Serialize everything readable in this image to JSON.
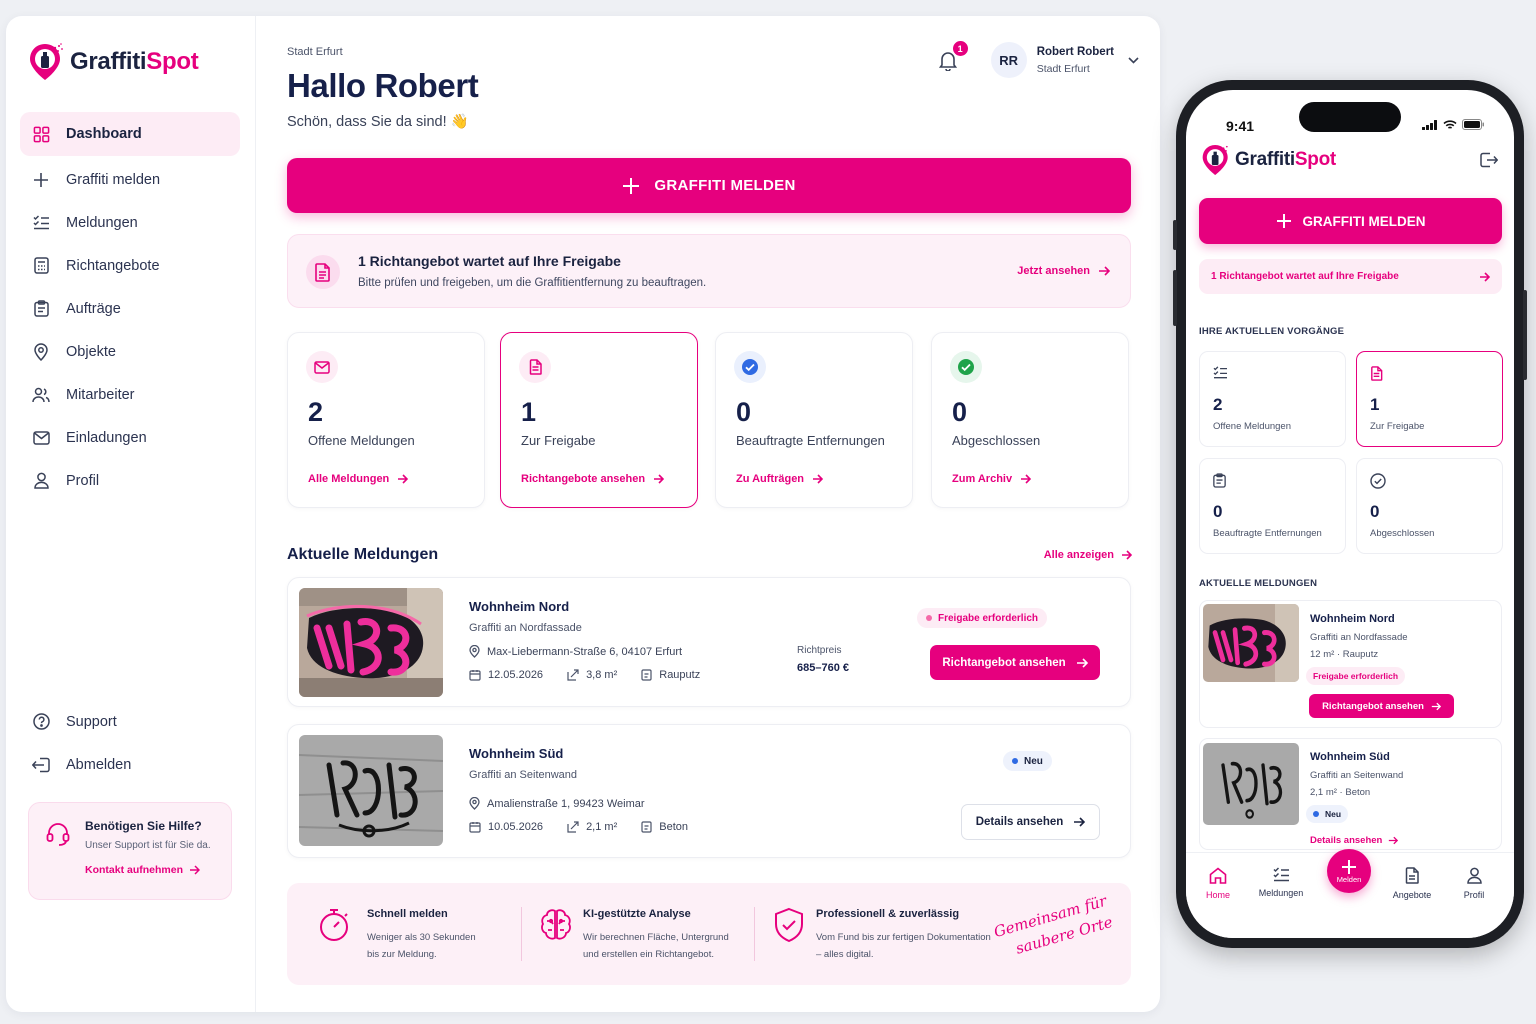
{
  "brand": {
    "name_part1": "Graffiti",
    "name_part2": "Spot",
    "accent": "#e6007e",
    "navy": "#16204a"
  },
  "sidebar": {
    "items": [
      {
        "label": "Dashboard",
        "icon": "grid-icon",
        "active": true
      },
      {
        "label": "Graffiti melden",
        "icon": "plus-icon"
      },
      {
        "label": "Meldungen",
        "icon": "list-check-icon"
      },
      {
        "label": "Richtangebote",
        "icon": "calculator-icon"
      },
      {
        "label": "Aufträge",
        "icon": "clipboard-icon"
      },
      {
        "label": "Objekte",
        "icon": "map-pin-icon"
      },
      {
        "label": "Mitarbeiter",
        "icon": "users-icon"
      },
      {
        "label": "Einladungen",
        "icon": "mail-icon"
      },
      {
        "label": "Profil",
        "icon": "user-icon"
      }
    ],
    "bottom": [
      {
        "label": "Support",
        "icon": "help-circle-icon"
      },
      {
        "label": "Abmelden",
        "icon": "logout-icon"
      }
    ],
    "help": {
      "title": "Benötigen Sie Hilfe?",
      "text": "Unser Support ist für Sie da.",
      "link": "Kontakt aufnehmen"
    }
  },
  "header": {
    "breadcrumb": "Stadt Erfurt",
    "greeting": "Hallo Robert",
    "subtitle": "Schön, dass Sie da sind! 👋",
    "notifications": "1",
    "user": {
      "initials": "RR",
      "name": "Robert Robert",
      "org": "Stadt Erfurt"
    }
  },
  "cta": {
    "label": "GRAFFITI MELDEN"
  },
  "notice": {
    "title": "1 Richtangebot wartet auf Ihre Freigabe",
    "text": "Bitte prüfen und freigeben, um die Graffitientfernung zu beauftragen.",
    "link": "Jetzt ansehen"
  },
  "stats": [
    {
      "value": "2",
      "label": "Offene Meldungen",
      "link": "Alle Meldungen",
      "icon": "mail-icon"
    },
    {
      "value": "1",
      "label": "Zur Freigabe",
      "link": "Richtangebote ansehen",
      "icon": "document-icon"
    },
    {
      "value": "0",
      "label": "Beauftragte Entfernungen",
      "link": "Zu Aufträgen",
      "icon": "check-badge-icon"
    },
    {
      "value": "0",
      "label": "Abgeschlossen",
      "link": "Zum Archiv",
      "icon": "check-circle-icon"
    }
  ],
  "reports": {
    "title": "Aktuelle Meldungen",
    "all_link": "Alle anzeigen",
    "items": [
      {
        "title": "Wohnheim Nord",
        "subtitle": "Graffiti an Nordfassade",
        "address": "Max-Liebermann-Straße 6, 04107 Erfurt",
        "date": "12.05.2026",
        "area": "3,8 m²",
        "surface": "Rauputz",
        "price_label": "Richtpreis",
        "price": "685–760 €",
        "status": "Freigabe erforderlich",
        "action": "Richtangebot ansehen"
      },
      {
        "title": "Wohnheim Süd",
        "subtitle": "Graffiti an Seitenwand",
        "address": "Amalienstraße 1, 99423 Weimar",
        "date": "10.05.2026",
        "area": "2,1 m²",
        "surface": "Beton",
        "status": "Neu",
        "action": "Details ansehen"
      }
    ]
  },
  "features": [
    {
      "title": "Schnell melden",
      "line1": "Weniger als 30 Sekunden",
      "line2": "bis zur Meldung.",
      "icon": "stopwatch-icon"
    },
    {
      "title": "KI-gestützte Analyse",
      "line1": "Wir berechnen Fläche, Untergrund",
      "line2": "und erstellen ein Richtangebot.",
      "icon": "brain-icon"
    },
    {
      "title": "Professionell & zuverlässig",
      "line1": "Vom Fund bis zur fertigen Dokumentation",
      "line2": "– alles digital.",
      "icon": "shield-check-icon"
    }
  ],
  "slogan": {
    "line1": "Gemeinsam für",
    "line2": "saubere Orte"
  },
  "mobile": {
    "time": "9:41",
    "cta": "GRAFFITI MELDEN",
    "notice": "1 Richtangebot wartet auf Ihre Freigabe",
    "section1": "IHRE AKTUELLEN VORGÄNGE",
    "stats": [
      {
        "value": "2",
        "label": "Offene Meldungen"
      },
      {
        "value": "1",
        "label": "Zur Freigabe"
      },
      {
        "value": "0",
        "label": "Beauftragte Entfernungen"
      },
      {
        "value": "0",
        "label": "Abgeschlossen"
      }
    ],
    "section2": "AKTUELLE MELDUNGEN",
    "cards": [
      {
        "title": "Wohnheim Nord",
        "subtitle": "Graffiti an Nordfassade",
        "meta": "12 m² · Rauputz",
        "status": "Freigabe erforderlich",
        "action": "Richtangebot ansehen"
      },
      {
        "title": "Wohnheim Süd",
        "subtitle": "Graffiti an Seitenwand",
        "meta": "2,1 m² · Beton",
        "status": "Neu",
        "action": "Details ansehen"
      }
    ],
    "tabs": [
      "Home",
      "Meldungen",
      "Melden",
      "Angebote",
      "Profil"
    ]
  }
}
